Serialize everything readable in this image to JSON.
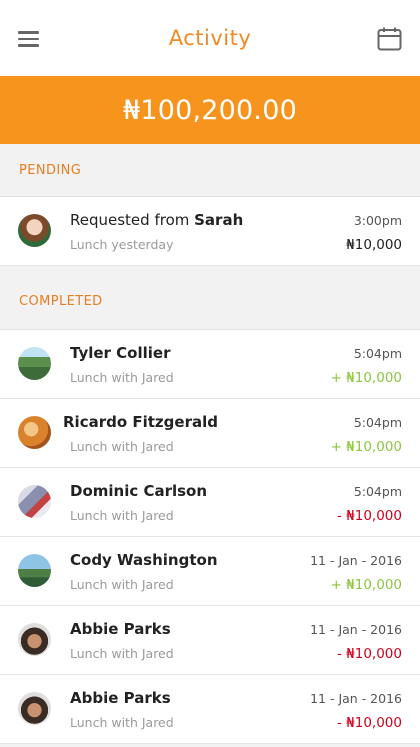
{
  "header": {
    "title": "Activity",
    "menu_icon": "menu-icon",
    "calendar_icon": "calendar-icon"
  },
  "balance": {
    "amount": "₦100,200.00"
  },
  "pending": {
    "label": "PENDING",
    "items": [
      {
        "name_prefix": "Requested from ",
        "name": "Sarah",
        "sub": "Lunch yesterday",
        "time": "3:00pm",
        "amount": "₦10,000"
      }
    ]
  },
  "completed": {
    "label": "COMPLETED",
    "items": [
      {
        "name": "Tyler Collier",
        "sub": "Lunch with Jared",
        "time": "5:04pm",
        "amount": "+ ₦10,000",
        "kind": "positive"
      },
      {
        "name": "Ricardo Fitzgerald",
        "sub": "Lunch with Jared",
        "time": "5:04pm",
        "amount": "+ ₦10,000",
        "kind": "positive"
      },
      {
        "name": "Dominic Carlson",
        "sub": "Lunch with Jared",
        "time": "5:04pm",
        "amount": "- ₦10,000",
        "kind": "negative"
      },
      {
        "name": "Cody Washington",
        "sub": "Lunch with Jared",
        "time": "11 - Jan - 2016",
        "amount": "+ ₦10,000",
        "kind": "positive"
      },
      {
        "name": "Abbie Parks",
        "sub": "Lunch with Jared",
        "time": "11 - Jan - 2016",
        "amount": "- ₦10,000",
        "kind": "negative"
      },
      {
        "name": "Abbie Parks",
        "sub": "Lunch with Jared",
        "time": "11 - Jan - 2016",
        "amount": "- ₦10,000",
        "kind": "negative"
      }
    ]
  },
  "colors": {
    "accent": "#f7941d",
    "positive": "#8dc63f",
    "negative": "#d0021b"
  }
}
